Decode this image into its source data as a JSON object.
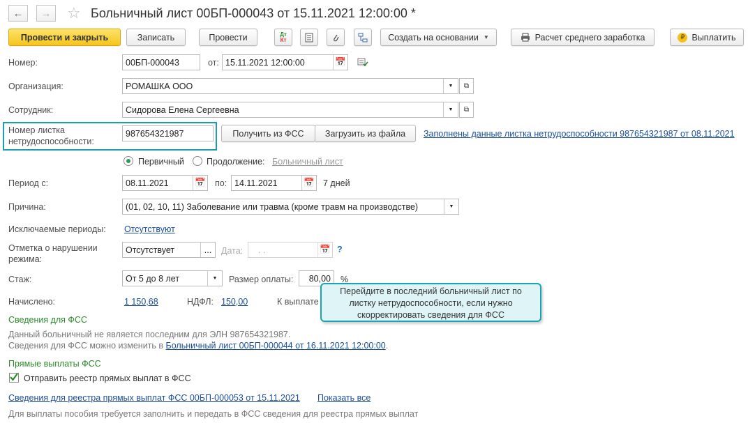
{
  "window": {
    "title": "Больничный лист 00БП-000043 от 15.11.2021 12:00:00 *"
  },
  "toolbar": {
    "post_close": "Провести и закрыть",
    "save": "Записать",
    "post": "Провести",
    "dt_kt_top": "Дт",
    "dt_kt_bottom": "Кт",
    "create_based": "Создать на основании",
    "avg_salary": "Расчет среднего заработка",
    "pay": "Выплатить"
  },
  "form": {
    "number_label": "Номер:",
    "number_value": "00БП-000043",
    "from_label": "от:",
    "date_value": "15.11.2021 12:00:00",
    "org_label": "Организация:",
    "org_value": "РОМАШКА ООО",
    "emp_label": "Сотрудник:",
    "emp_value": "Сидорова Елена Сергеевна",
    "sick_label_1": "Номер листка",
    "sick_label_2": "нетрудоспособности:",
    "sick_value": "987654321987",
    "get_fss": "Получить из ФСС",
    "load_file": "Загрузить из файла",
    "filled_link": "Заполнены данные листка нетрудоспособности 987654321987 от 08.11.2021",
    "primary_label": "Первичный",
    "continuation_label": "Продолжение:",
    "sick_list_link": "Больничный лист",
    "period_label": "Период с:",
    "period_from": "08.11.2021",
    "period_to_label": "по:",
    "period_to": "14.11.2021",
    "days": "7 дней",
    "reason_label": "Причина:",
    "reason_value": "(01, 02, 10, 11) Заболевание или травма (кроме травм на производстве)",
    "excluded_label": "Исключаемые периоды:",
    "excluded_value": "Отсутствуют",
    "violation_label_1": "Отметка о нарушении",
    "violation_label_2": "режима:",
    "violation_value": "Отсутствует",
    "violation_date_label": "Дата:",
    "violation_date_value": ".  .",
    "help": "?",
    "experience_label": "Стаж:",
    "experience_value": "От 5 до 8 лет",
    "pay_size_label": "Размер оплаты:",
    "pay_size_value": "80,00",
    "percent": "%",
    "accrued_label": "Начислено:",
    "accrued_value": "1 150,68",
    "ndfl_label": "НДФЛ:",
    "ndfl_value": "150,00",
    "payout_label": "К выплате"
  },
  "fss": {
    "heading": "Сведения для ФСС",
    "line1": "Данный больничный не является последним для ЭЛН 987654321987.",
    "line2_prefix": "Сведения для ФСС можно изменить в",
    "line2_link": "Больничный лист 00БП-000044 от 16.11.2021 12:00:00",
    "line2_suffix": "."
  },
  "direct": {
    "heading": "Прямые выплаты ФСС",
    "checkbox_label": "Отправить реестр прямых выплат в ФСС",
    "registry_link": "Сведения для реестра прямых выплат ФСС 00БП-000053 от 15.11.2021",
    "show_all": "Показать все",
    "note": "Для выплаты пособия требуется заполнить и передать в ФСС сведения для реестра прямых выплат"
  },
  "tooltip": {
    "line1": "Перейдите в последний больничный лист по",
    "line2": "листку нетрудоспособности, если нужно",
    "line3": "скорректировать сведения для ФСС"
  },
  "colors": {
    "primary": "#f5c51c",
    "link": "#1a4ea0",
    "section": "#2a8a2a",
    "accent": "#1aa3b0"
  }
}
